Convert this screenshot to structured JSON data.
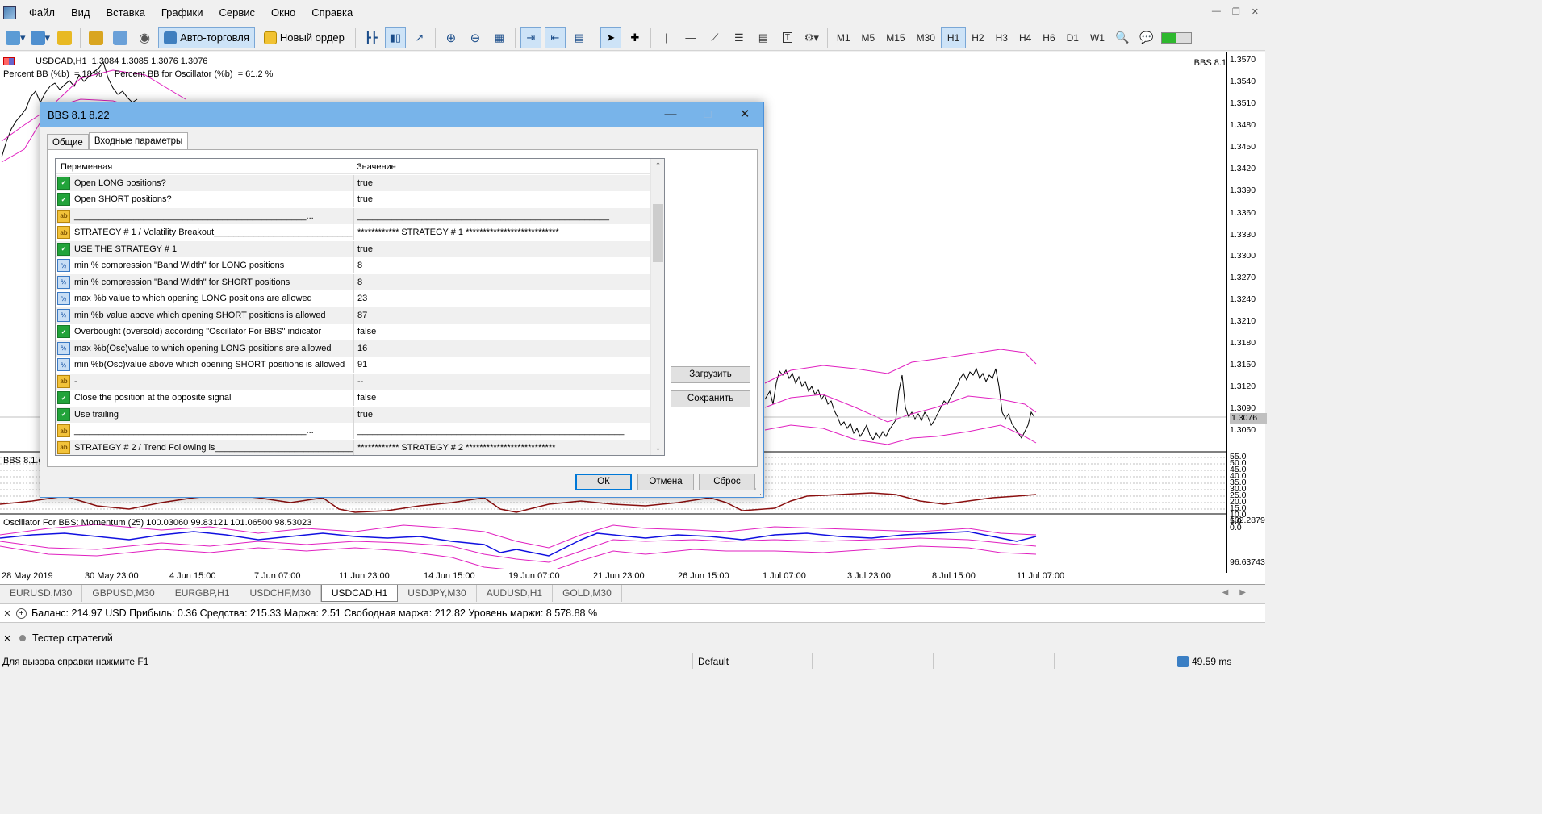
{
  "menu": [
    "Файл",
    "Вид",
    "Вставка",
    "Графики",
    "Сервис",
    "Окно",
    "Справка"
  ],
  "toolbar": {
    "autotrading_label": "Авто-торговля",
    "new_order_label": "Новый ордер",
    "timeframes": [
      "M1",
      "M5",
      "M15",
      "M30",
      "H1",
      "H2",
      "H3",
      "H4",
      "H6",
      "D1",
      "W1"
    ],
    "active_timeframe": "H1"
  },
  "chart": {
    "header": "USDCAD,H1  1.3084 1.3085 1.3076 1.3076",
    "indicator_info": "Percent BB (%b)  = 18 %     Percent BB for Oscillator (%b)  = 61.2 %",
    "indicator_label": "BBS 8.1",
    "price_levels": [
      "1.3570",
      "1.3540",
      "1.3510",
      "1.3480",
      "1.3450",
      "1.3420",
      "1.3390",
      "1.3360",
      "1.3330",
      "1.3300",
      "1.3270",
      "1.3240",
      "1.3210",
      "1.3180",
      "1.3150",
      "1.3120",
      "1.3090",
      "1.3076",
      "1.3060"
    ],
    "current_price": "1.3076",
    "subwindow1_label": "BBS 8.1.e",
    "subwindow1_scale": [
      "55.0",
      "50.0",
      "45.0",
      "40.0",
      "35.0",
      "30.0",
      "25.0",
      "20.0",
      "15.0",
      "10.0",
      "5.0",
      "0.0"
    ],
    "subwindow2_label": "Oscillator For BBS: Momentum (25) 100.03060 99.83121 101.06500 98.53023",
    "subwindow2_scale_top": "102.2879",
    "subwindow2_scale_bottom": "96.63743",
    "time_labels": [
      "28 May 2019",
      "30 May 23:00",
      "4 Jun 15:00",
      "7 Jun 07:00",
      "11 Jun 23:00",
      "14 Jun 15:00",
      "19 Jun 07:00",
      "21 Jun 23:00",
      "26 Jun 15:00",
      "1 Jul 07:00",
      "3 Jul 23:00",
      "8 Jul 15:00",
      "11 Jul 07:00"
    ]
  },
  "chart_tabs": [
    "EURUSD,M30",
    "GBPUSD,M30",
    "EURGBP,H1",
    "USDCHF,M30",
    "USDCAD,H1",
    "USDJPY,M30",
    "AUDUSD,H1",
    "GOLD,M30"
  ],
  "active_chart_tab": "USDCAD,H1",
  "terminal": {
    "text": "Баланс: 214.97 USD  Прибыль: 0.36  Средства: 215.33  Маржа: 2.51  Свободная маржа: 212.82  Уровень маржи: 8 578.88 %"
  },
  "tester": {
    "label": "Тестер стратегий"
  },
  "statusbar": {
    "help": "Для вызова справки нажмите F1",
    "profile": "Default",
    "ping": "49.59 ms"
  },
  "dialog": {
    "title": "BBS 8.1 8.22",
    "tabs": [
      "Общие",
      "Входные параметры"
    ],
    "active_tab": "Входные параметры",
    "columns": {
      "variable": "Переменная",
      "value": "Значение"
    },
    "params": [
      {
        "type": "bool",
        "name": "Open LONG positions?",
        "value": "true"
      },
      {
        "type": "bool",
        "name": "Open SHORT positions?",
        "value": "true"
      },
      {
        "type": "str",
        "name": "_______________________________________________...",
        "value": "___________________________________________________"
      },
      {
        "type": "str",
        "name": "STRATEGY # 1 / Volatility Breakout____________________________",
        "value": "************ STRATEGY # 1 ***************************"
      },
      {
        "type": "bool",
        "name": "USE THE STRATEGY # 1",
        "value": "true"
      },
      {
        "type": "num",
        "name": "min % compression \"Band Width\" for LONG positions",
        "value": "8"
      },
      {
        "type": "num",
        "name": "min % compression \"Band Width\" for SHORT positions",
        "value": "8"
      },
      {
        "type": "num",
        "name": "max %b value to which opening LONG positions are allowed",
        "value": "23"
      },
      {
        "type": "num",
        "name": "min %b value above which opening SHORT positions is allowed",
        "value": "87"
      },
      {
        "type": "bool",
        "name": "Overbought (oversold) according \"Oscillator For BBS\" indicator",
        "value": "false"
      },
      {
        "type": "num",
        "name": "max %b(Osc)value to which opening LONG positions are allowed",
        "value": "16"
      },
      {
        "type": "num",
        "name": "min %b(Osc)value above which opening SHORT positions is allowed",
        "value": "91"
      },
      {
        "type": "str",
        "name": "-",
        "value": "--"
      },
      {
        "type": "bool",
        "name": "Close the position at the opposite signal",
        "value": "false"
      },
      {
        "type": "bool",
        "name": "Use trailing",
        "value": "true"
      },
      {
        "type": "str",
        "name": "_______________________________________________...",
        "value": "______________________________________________________"
      },
      {
        "type": "str",
        "name": "STRATEGY # 2 / Trend Following is____________________________",
        "value": "************ STRATEGY # 2 **************************"
      }
    ],
    "buttons": {
      "load": "Загрузить",
      "save": "Сохранить",
      "ok": "ОК",
      "cancel": "Отмена",
      "reset": "Сброс"
    }
  }
}
